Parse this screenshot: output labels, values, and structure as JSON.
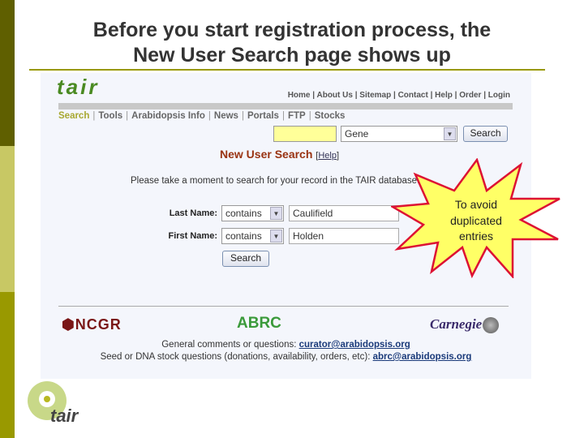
{
  "slide": {
    "title_line1": "Before you start registration process, the",
    "title_line2": "New User Search page shows up",
    "callout": [
      "To avoid",
      "duplicated",
      "entries"
    ],
    "logo_text": "tair",
    "colors": {
      "bar_top": "#5f5f00",
      "bar_mid": "#c8c864",
      "bar_bottom": "#999900",
      "callout_fill": "#ffff66",
      "callout_stroke": "#dd1133"
    }
  },
  "site": {
    "logo": "tair",
    "top_links": [
      "Home",
      "About Us",
      "Sitemap",
      "Contact",
      "Help",
      "Order",
      "Login"
    ],
    "nav": [
      "Search",
      "Tools",
      "Arabidopsis Info",
      "News",
      "Portals",
      "FTP",
      "Stocks"
    ],
    "search": {
      "value": "",
      "category": "Gene",
      "button": "Search"
    },
    "heading": "New User Search",
    "help": "Help",
    "message": "Please take a moment to search for your record in the TAIR database.",
    "form": {
      "last_label": "Last Name:",
      "last_op": "contains",
      "last_value": "Caulifield",
      "first_label": "First Name:",
      "first_op": "contains",
      "first_value": "Holden",
      "button": "Search"
    },
    "sponsors": [
      "NCGR",
      "ABRC",
      "Carnegie"
    ],
    "footer1_text": "General comments or questions:",
    "footer1_email": "curator@arabidopsis.org",
    "footer2_text": "Seed or DNA stock questions (donations, availability, orders, etc):",
    "footer2_email": "abrc@arabidopsis.org"
  }
}
